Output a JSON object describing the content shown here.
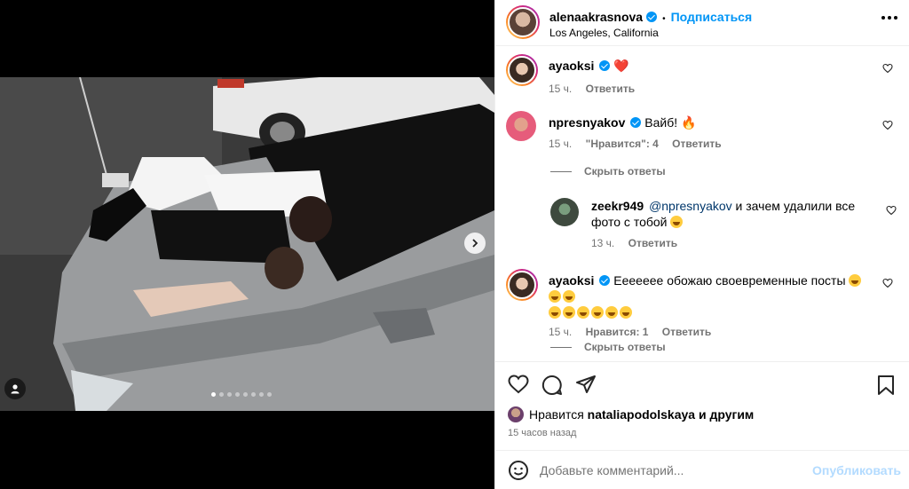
{
  "post": {
    "author": "alenaakrasnova",
    "follow_label": "Подписаться",
    "separator": "•",
    "location": "Los Angeles, California"
  },
  "carousel": {
    "dots": 8,
    "active_index": 0
  },
  "comments": [
    {
      "user": "ayaoksi",
      "verified": true,
      "text": "❤️",
      "time": "15 ч.",
      "reply": "Ответить"
    },
    {
      "user": "npresnyakov",
      "verified": true,
      "text": "Вайб! 🔥",
      "time": "15 ч.",
      "likes": "\"Нравится\": 4",
      "reply": "Ответить",
      "hide_replies": "Скрыть ответы",
      "replies": [
        {
          "user": "zeekr949",
          "mention": "@npresnyakov",
          "text": " и зачем удалили все фото с тобой ",
          "time": "13 ч.",
          "reply": "Ответить"
        }
      ]
    },
    {
      "user": "ayaoksi",
      "verified": true,
      "text": "Еееееее обожаю своевременные посты",
      "time": "15 ч.",
      "likes": "Нравится: 1",
      "reply": "Ответить",
      "hide_replies": "Скрыть ответы"
    }
  ],
  "likes": {
    "prefix": "Нравится",
    "user": "nataliapodolskaya",
    "suffix": "и другим"
  },
  "time_ago": "15 часов назад",
  "add_comment": {
    "placeholder": "Добавьте комментарий...",
    "post_label": "Опубликовать"
  },
  "colors": {
    "accent": "#0095f6",
    "muted": "#737373",
    "mention": "#00376b",
    "post_disabled": "#b3dbff"
  }
}
